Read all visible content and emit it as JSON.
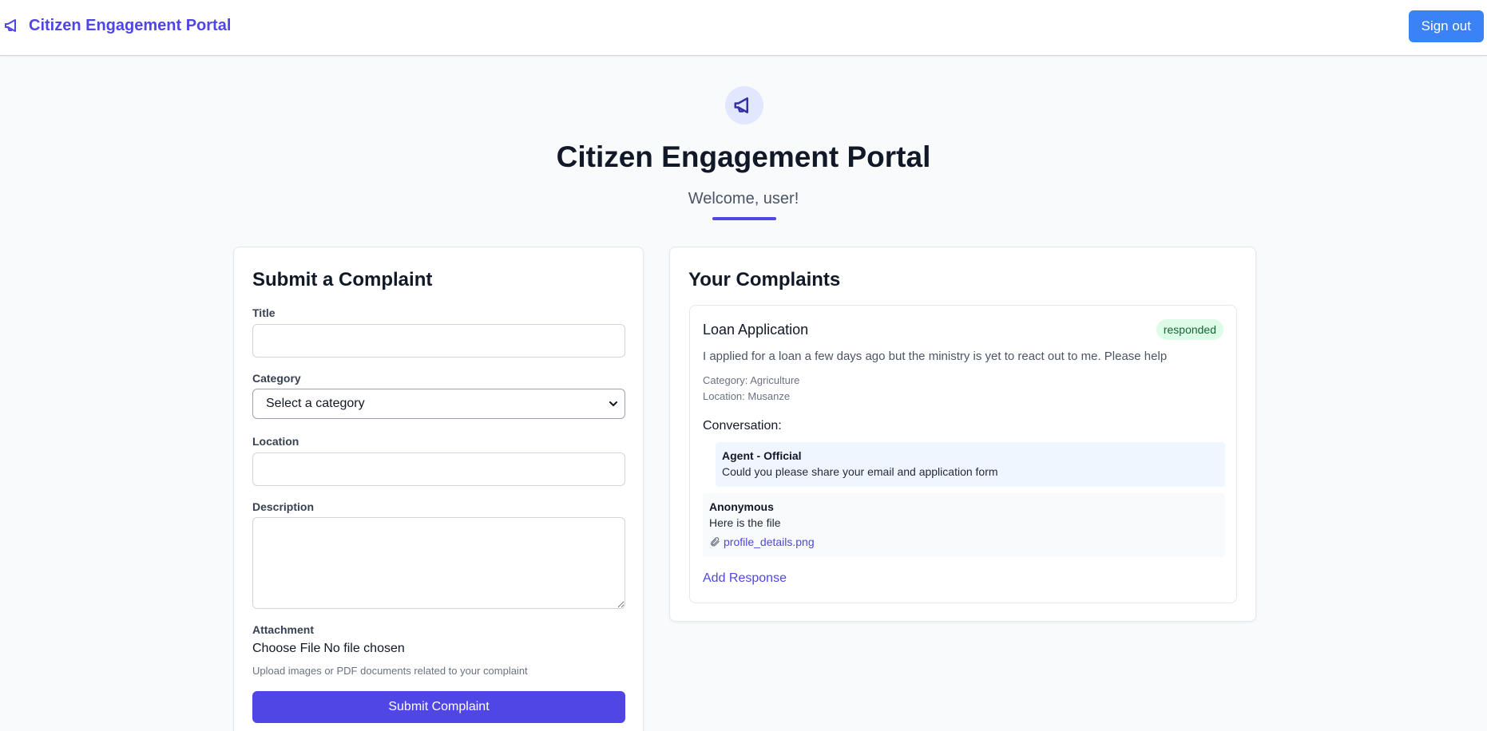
{
  "header": {
    "brand": "Citizen Engagement Portal",
    "brand_icon": "megaphone-icon",
    "sign_out": "Sign out"
  },
  "hero": {
    "icon": "megaphone-icon",
    "title": "Citizen Engagement Portal",
    "welcome": "Welcome, user!"
  },
  "form": {
    "title": "Submit a Complaint",
    "title_label": "Title",
    "title_value": "",
    "category_label": "Category",
    "category_selected": "Select a category",
    "location_label": "Location",
    "location_value": "",
    "description_label": "Description",
    "description_value": "",
    "attachment_label": "Attachment",
    "choose_file": "Choose File",
    "no_file": "No file chosen",
    "hint": "Upload images or PDF documents related to your complaint",
    "submit": "Submit Complaint"
  },
  "complaints": {
    "title": "Your Complaints",
    "items": [
      {
        "title": "Loan Application",
        "status": "responded",
        "description": "I applied for a loan a few days ago but the ministry is yet to react out to me. Please help",
        "category": "Category: Agriculture",
        "location": "Location: Musanze",
        "conversation_label": "Conversation:",
        "messages": [
          {
            "author": "Agent - Official",
            "text": "Could you please share your email and application form"
          },
          {
            "author": "Anonymous",
            "text": "Here is the file",
            "attachment": "profile_details.png"
          }
        ],
        "add_response": "Add Response"
      }
    ]
  },
  "colors": {
    "accent": "#4f46e5",
    "sign_out_bg": "#3b82f6",
    "badge_bg": "#dcfce7",
    "badge_text": "#166534",
    "agent_bg": "#eff6ff"
  }
}
